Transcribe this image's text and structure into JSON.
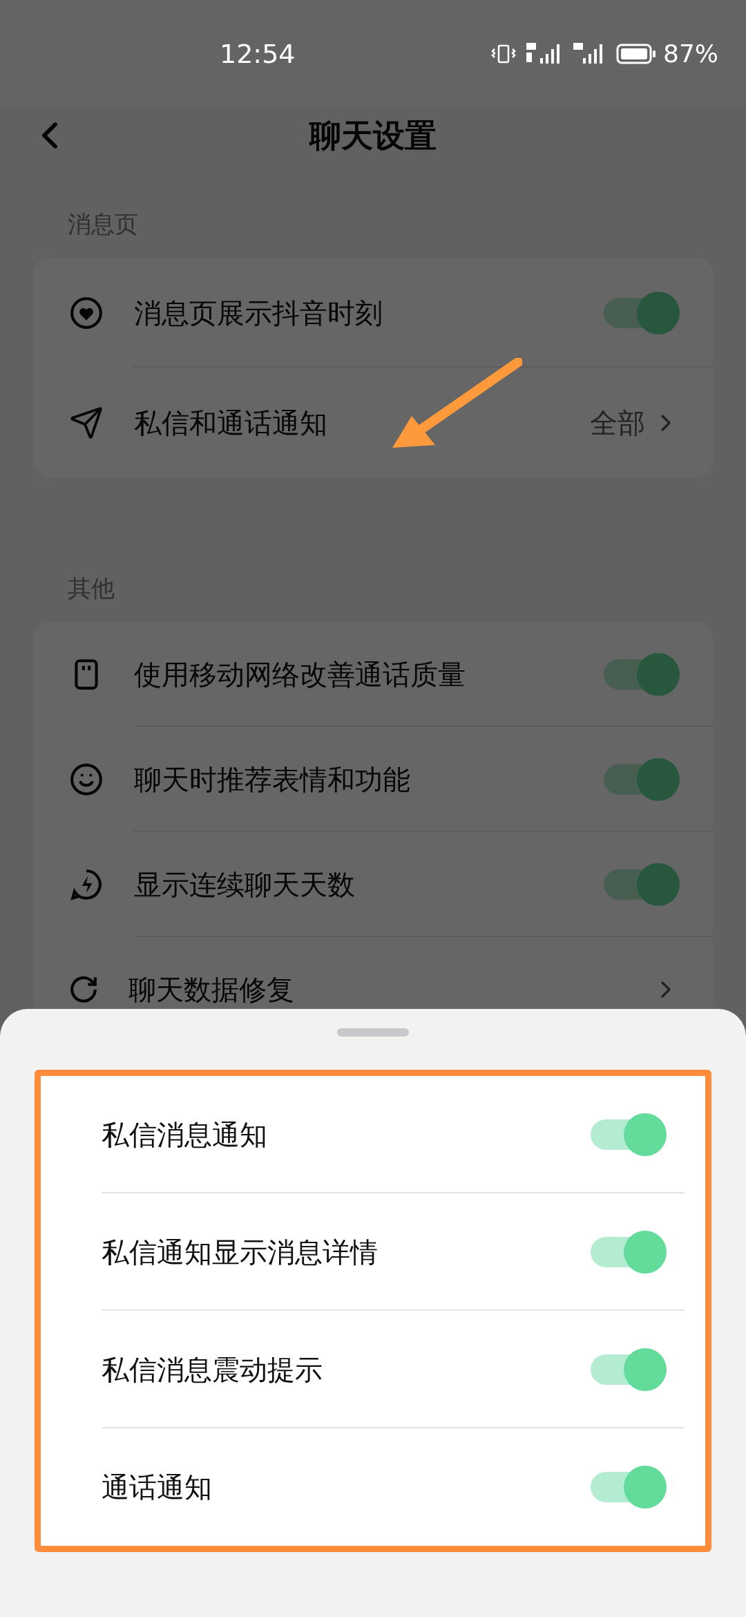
{
  "status_bar": {
    "time": "12:54",
    "battery": "87%"
  },
  "header": {
    "title": "聊天设置"
  },
  "sections": [
    {
      "label": "消息页",
      "items": [
        {
          "kind": "toggle",
          "label": "消息页展示抖音时刻",
          "on": true
        },
        {
          "kind": "link",
          "label": "私信和通话通知",
          "value": "全部"
        }
      ]
    },
    {
      "label": "其他",
      "items": [
        {
          "kind": "toggle",
          "label": "使用移动网络改善通话质量",
          "on": true
        },
        {
          "kind": "toggle",
          "label": "聊天时推荐表情和功能",
          "on": true
        },
        {
          "kind": "toggle",
          "label": "显示连续聊天天数",
          "on": true
        },
        {
          "kind": "link",
          "label": "聊天数据修复"
        }
      ]
    }
  ],
  "sheet": {
    "items": [
      {
        "label": "私信消息通知",
        "on": true
      },
      {
        "label": "私信通知显示消息详情",
        "on": true
      },
      {
        "label": "私信消息震动提示",
        "on": true
      },
      {
        "label": "通话通知",
        "on": true
      }
    ]
  }
}
